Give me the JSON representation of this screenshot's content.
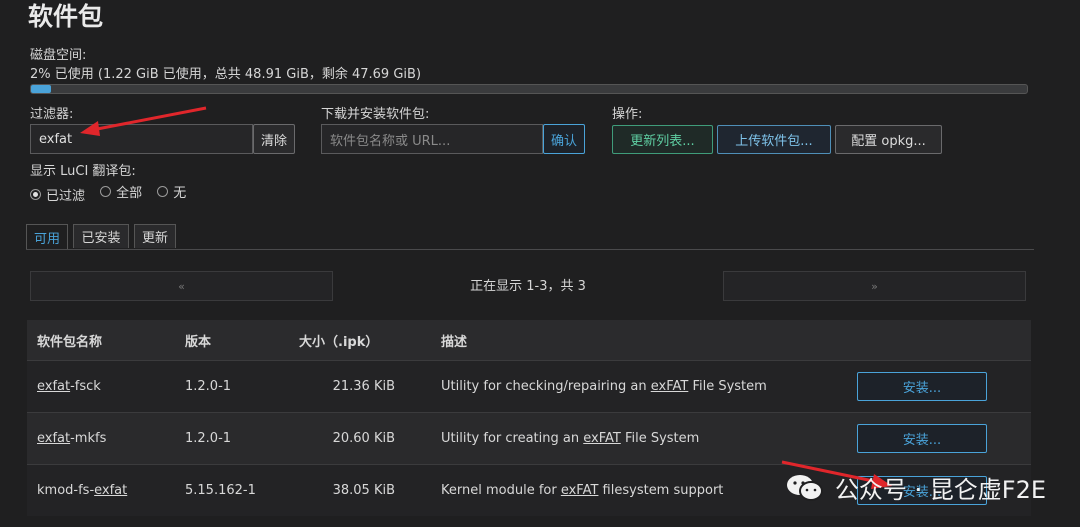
{
  "page": {
    "title": "软件包"
  },
  "disk": {
    "label": "磁盘空间:",
    "summary": "2% 已使用 (1.22 GiB 已使用，总共 48.91 GiB，剩余 47.69 GiB)",
    "used_fraction": 0.02
  },
  "filter": {
    "label": "过滤器:",
    "value": "exfat",
    "clear_label": "清除"
  },
  "download": {
    "label": "下载并安装软件包:",
    "placeholder": "软件包名称或 URL...",
    "confirm_label": "确认"
  },
  "actions": {
    "label": "操作:",
    "update_lists": "更新列表...",
    "upload": "上传软件包...",
    "configure": "配置 opkg..."
  },
  "luci": {
    "label": "显示 LuCI 翻译包:",
    "options": [
      "已过滤",
      "全部",
      "无"
    ],
    "selected": "已过滤"
  },
  "tabs": [
    "可用",
    "已安装",
    "更新"
  ],
  "pager": {
    "prev": "«",
    "next": "»",
    "status": "正在显示 1-3，共 3"
  },
  "table": {
    "headers": [
      "软件包名称",
      "版本",
      "大小（.ipk）",
      "描述"
    ],
    "rows": [
      {
        "name_match": "exfat",
        "name_rest": "-fsck",
        "version": "1.2.0-1",
        "size": "21.36 KiB",
        "desc_pre": "Utility for checking/repairing an ",
        "desc_match": "exFAT",
        "desc_post": " File System",
        "action": "安装..."
      },
      {
        "name_match": "exfat",
        "name_rest": "-mkfs",
        "version": "1.2.0-1",
        "size": "20.60 KiB",
        "desc_pre": "Utility for creating an ",
        "desc_match": "exFAT",
        "desc_post": " File System",
        "action": "安装..."
      },
      {
        "name_pre": "kmod-fs-",
        "name_match": "exfat",
        "version": "5.15.162-1",
        "size": "38.05 KiB",
        "desc_pre": "Kernel module for ",
        "desc_match": "exFAT",
        "desc_post": " filesystem support",
        "action": "安装..."
      }
    ]
  },
  "watermark": {
    "text": "公众号 · 昆仑虚F2E",
    "icon": "wechat-icon"
  },
  "annotation": {
    "icon": "red-arrow-icon",
    "color": "#e0262b"
  }
}
